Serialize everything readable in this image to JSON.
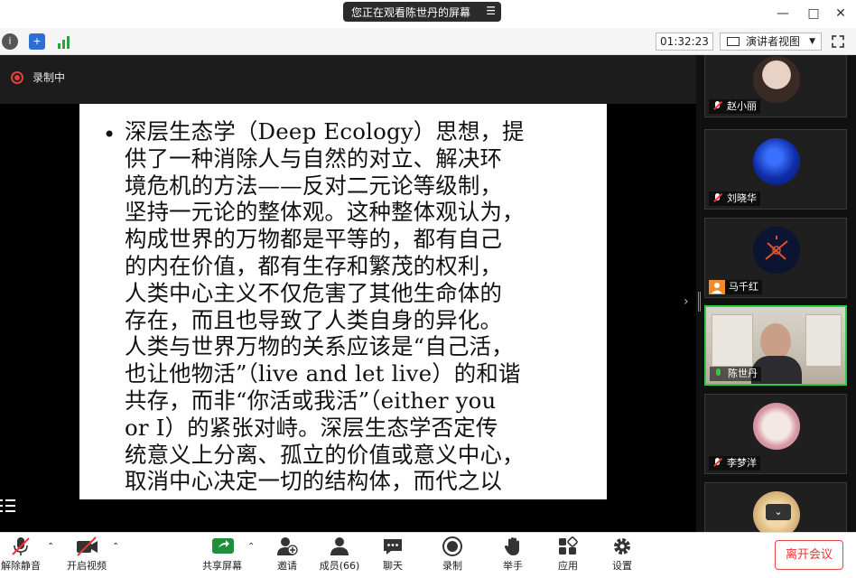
{
  "top_banner": {
    "text": "您正在观看陈世丹的屏幕"
  },
  "window_controls": {
    "minimize": "—",
    "maximize": "□",
    "close": "✕"
  },
  "toolbar": {
    "timer": "01:32:23",
    "view_label": "演讲者视图"
  },
  "recording": {
    "label": "录制中",
    "color": "#e04040"
  },
  "slide": {
    "bullet": "•",
    "lines": [
      "深层生态学（Deep Ecology）思想，提",
      "供了一种消除人与自然的对立、解决环",
      "境危机的方法——反对二元论等级制，",
      "坚持一元论的整体观。这种整体观认为，",
      "构成世界的万物都是平等的，都有自己",
      "的内在价值，都有生存和繁茂的权利，",
      "人类中心主义不仅危害了其他生命体的",
      "存在，而且也导致了人类自身的异化。",
      "人类与世界万物的关系应该是“自己活，",
      "也让他物活”（live and let live）的和谐",
      "共存，而非“你活或我活”（either you",
      "or I）的紧张对峙。深层生态学否定传",
      "统意义上分离、孤立的价值或意义中心，",
      "取消中心决定一切的结构体，而代之以"
    ]
  },
  "participants": [
    {
      "name": "赵小丽",
      "muted": true
    },
    {
      "name": "刘晓华",
      "muted": true
    },
    {
      "name": "马千红",
      "muted": false
    },
    {
      "name": "陈世丹",
      "muted": false,
      "active": true
    },
    {
      "name": "李梦洋",
      "muted": true
    }
  ],
  "bottom_toolbar": {
    "unmute": "解除静音",
    "start_video": "开启视频",
    "share_screen": "共享屏幕",
    "invite": "邀请",
    "participants": "成员(66)",
    "chat": "聊天",
    "record": "录制",
    "raise_hand": "举手",
    "apps": "应用",
    "settings": "设置",
    "leave": "离开会议"
  },
  "colors": {
    "accent_green": "#2ecc40",
    "leave_red": "#e33333",
    "share_green": "#1f8f3a"
  }
}
